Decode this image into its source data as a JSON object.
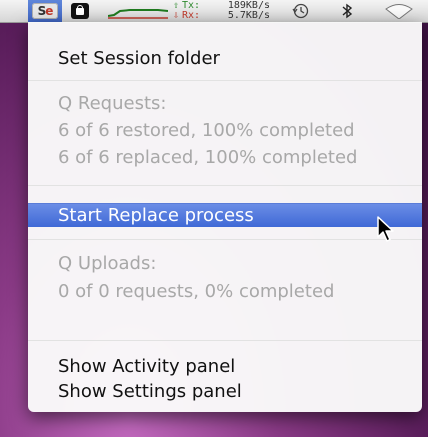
{
  "menubar": {
    "app_badge_left": "S",
    "app_badge_right": "e",
    "network": {
      "tx_label": "Tx:",
      "tx_value": "189KB/s",
      "rx_label": "Rx:",
      "rx_value": "5.7KB/s"
    },
    "icons": [
      "lock-icon",
      "network-graph-icon",
      "time-machine-icon",
      "bluetooth-icon",
      "wifi-icon"
    ]
  },
  "menu": {
    "set_session_folder": "Set Session folder",
    "q_requests_header": "Q Requests:",
    "restored_status": "6 of 6 restored, 100% completed",
    "replaced_status": "6 of 6 replaced, 100% completed",
    "start_replace": "Start Replace process",
    "q_uploads_header": "Q Uploads:",
    "uploads_status": "0 of 0 requests, 0% completed",
    "show_activity": "Show Activity panel",
    "show_settings": "Show Settings panel"
  },
  "colors": {
    "highlight": "#4a73dd",
    "disabled_text": "#a8a8a8",
    "tx": "#2f8a2f",
    "rx": "#c0392b"
  }
}
